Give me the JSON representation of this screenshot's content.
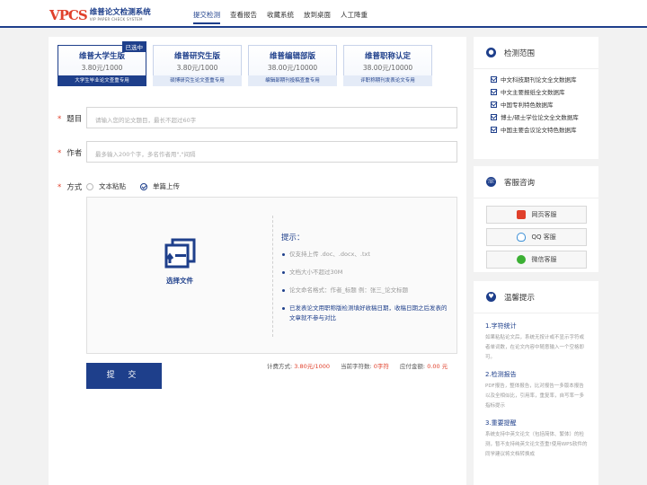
{
  "header": {
    "logo_mark": "VPCS",
    "logo_cn": "维普论文检测系统",
    "logo_en": "VIP PAPER CHECK SYSTEM",
    "nav": [
      "提交检测",
      "查看报告",
      "收藏系统",
      "放到桌面",
      "人工降重"
    ]
  },
  "cards": [
    {
      "name": "维普大学生版",
      "price": "3.80元/1000",
      "desc": "大学生毕业论文查重专用",
      "badge": "已选中"
    },
    {
      "name": "维普研究生版",
      "price": "3.80元/1000",
      "desc": "硕博研究生论文查重专用"
    },
    {
      "name": "维普编辑部版",
      "price": "38.00元/10000",
      "desc": "编辑部期刊投稿查重专用"
    },
    {
      "name": "维普职称认定",
      "price": "38.00元/10000",
      "desc": "评职称期刊发表论文专用"
    }
  ],
  "form": {
    "title_label": "题目",
    "title_placeholder": "请输入您的论文题目，最长不超过60字",
    "author_label": "作者",
    "author_placeholder": "最多输入200个字，多名作者用\",\"间隔",
    "mode_label": "方式",
    "mode_options": [
      "文本粘贴",
      "单篇上传"
    ],
    "upload_label": "选择文件",
    "tips_title": "提示：",
    "tips": [
      "仅支持上传 .doc、.docx、.txt",
      "文档大小不超过30M",
      "论文命名格式：作者_标题 例：张三_论文标题",
      "已发表论文用职称版检测填好收稿日期，收稿日期之后发表的文章就不参与对比"
    ],
    "fee_label": "计费方式:",
    "fee_value": "3.80元/1000",
    "chars_label": "当前字符数:",
    "chars_value": "0字符",
    "amount_label": "应付金额:",
    "amount_value": "0.00 元",
    "submit": "提 交"
  },
  "sidebar": {
    "scope_title": "检测范围",
    "scope_items": [
      "中文科技期刊论文全文数据库",
      "中文主要报纸全文数据库",
      "中国专利特色数据库",
      "博士/硕士学位论文全文数据库",
      "中国主要会议论文特色数据库"
    ],
    "service_title": "客服咨询",
    "services": [
      "网页客服",
      "QQ 客服",
      "微信客服"
    ],
    "notice_title": "温馨提示",
    "notices": [
      {
        "h": "1.字符统计",
        "p": "如果粘贴论文后，系统无按计或不显示字符或者单词数，在论文内容中随意输入一个空格即可。"
      },
      {
        "h": "2.检测报告",
        "p": "PDF报告，整体报告，比对报告一多版本报告以及全相似比，引用率，重复率，自写率一多指标提示"
      },
      {
        "h": "3.重要提醒",
        "p": "系统支持中英文论文（包括简体、繁体）的检测，暂不支持纯英文论文查重!使用WPS软件的同学建议将文档转换成"
      }
    ]
  },
  "colors": {
    "primary": "#1e3f8b",
    "accent": "#e0402b"
  }
}
